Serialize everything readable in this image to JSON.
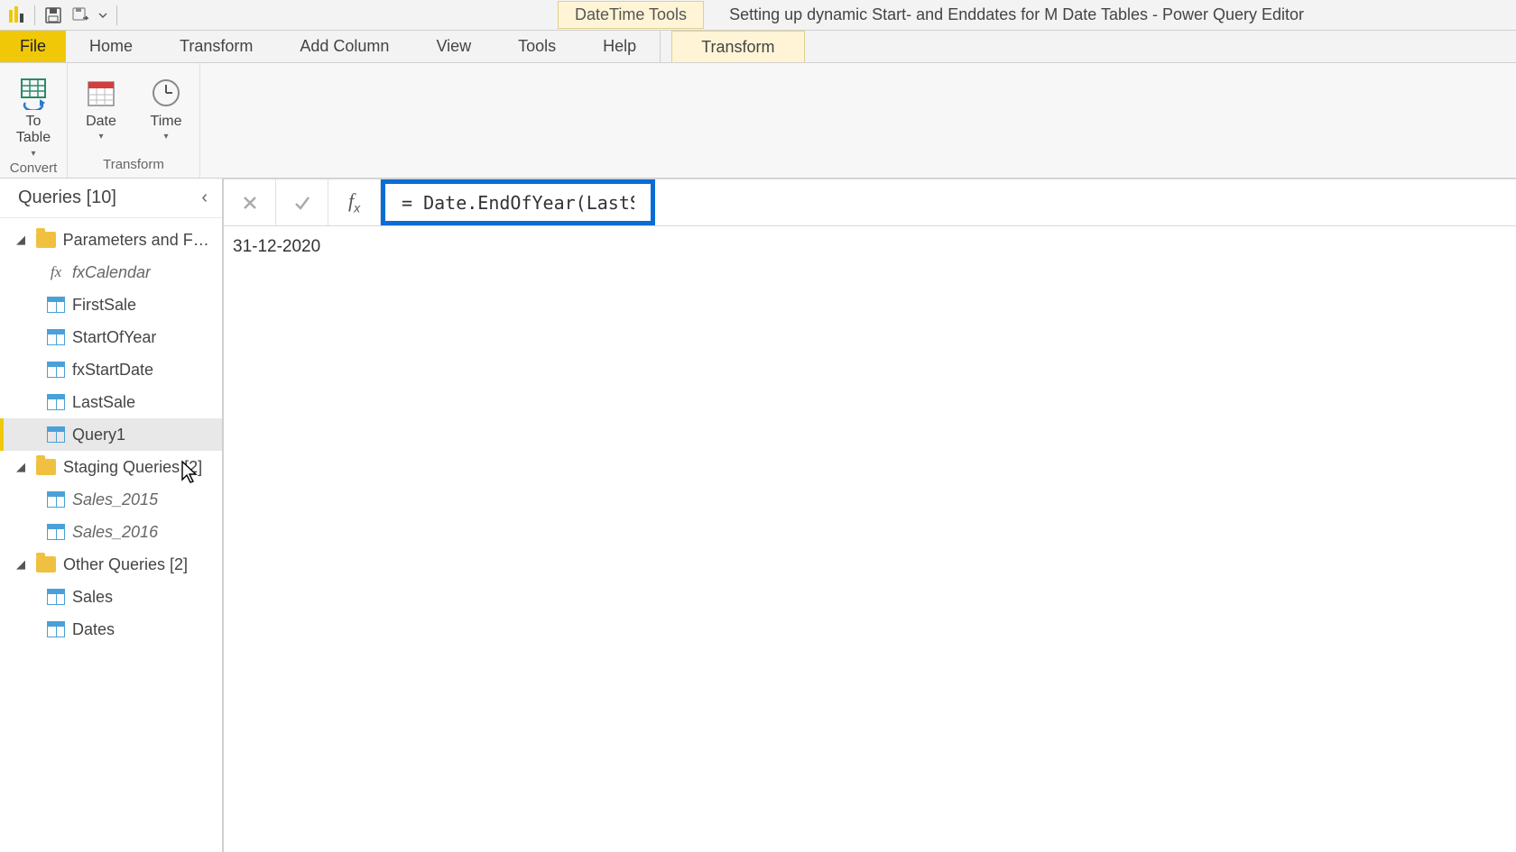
{
  "titlebar": {
    "context_tab_title": "DateTime Tools",
    "window_title": "Setting up dynamic Start- and Enddates for M Date Tables - Power Query Editor"
  },
  "tabs": {
    "file": "File",
    "home": "Home",
    "transform": "Transform",
    "add_column": "Add Column",
    "view": "View",
    "tools": "Tools",
    "help": "Help",
    "context_transform": "Transform"
  },
  "ribbon": {
    "to_table": "To\nTable",
    "date": "Date",
    "time": "Time",
    "group_convert": "Convert",
    "group_transform": "Transform"
  },
  "queries": {
    "header": "Queries [10]",
    "groups": [
      {
        "label": "Parameters and Fu…",
        "items": [
          {
            "label": "fxCalendar",
            "icon": "fx",
            "italic": true
          },
          {
            "label": "FirstSale",
            "icon": "table"
          },
          {
            "label": "StartOfYear",
            "icon": "table"
          },
          {
            "label": "fxStartDate",
            "icon": "table"
          },
          {
            "label": "LastSale",
            "icon": "table"
          },
          {
            "label": "Query1",
            "icon": "table",
            "selected": true
          }
        ]
      },
      {
        "label": "Staging Queries [2]",
        "items": [
          {
            "label": "Sales_2015",
            "icon": "table",
            "italic": true
          },
          {
            "label": "Sales_2016",
            "icon": "table",
            "italic": true
          }
        ]
      },
      {
        "label": "Other Queries [2]",
        "items": [
          {
            "label": "Sales",
            "icon": "table"
          },
          {
            "label": "Dates",
            "icon": "table"
          }
        ]
      }
    ]
  },
  "formula_bar": {
    "formula": "= Date.EndOfYear(LastSale)"
  },
  "result": {
    "value": "31-12-2020"
  }
}
